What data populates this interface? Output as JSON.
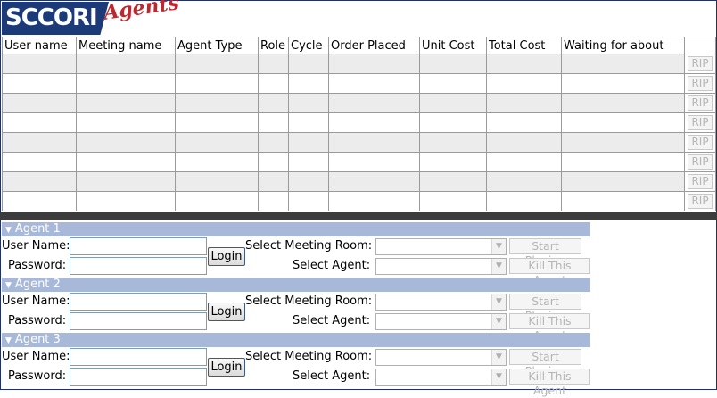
{
  "logo": {
    "brand": "SCCORI",
    "product": "Agents"
  },
  "table": {
    "headers": [
      "User name",
      "Meeting name",
      "Agent Type",
      "Role",
      "Cycle",
      "Order Placed",
      "Unit Cost",
      "Total Cost",
      "Waiting for about",
      ""
    ],
    "row_count": 8,
    "rip_label": "RIP"
  },
  "agents": [
    {
      "title": "Agent 1",
      "username_label": "User Name:",
      "password_label": "Password:",
      "username": "",
      "password": "",
      "login_label": "Login",
      "meeting_label": "Select Meeting Room:",
      "agent_label": "Select Agent:",
      "meeting_value": "",
      "agent_value": "",
      "start_label": "Start Playing",
      "kill_label": "Kill This Agent"
    },
    {
      "title": "Agent 2",
      "username_label": "User Name:",
      "password_label": "Password:",
      "username": "",
      "password": "",
      "login_label": "Login",
      "meeting_label": "Select Meeting Room:",
      "agent_label": "Select Agent:",
      "meeting_value": "",
      "agent_value": "",
      "start_label": "Start Playing",
      "kill_label": "Kill This Agent"
    },
    {
      "title": "Agent 3",
      "username_label": "User Name:",
      "password_label": "Password:",
      "username": "",
      "password": "",
      "login_label": "Login",
      "meeting_label": "Select Meeting Room:",
      "agent_label": "Select Agent:",
      "meeting_value": "",
      "agent_value": "",
      "start_label": "Start Playing",
      "kill_label": "Kill This Agent"
    }
  ],
  "colors": {
    "header_band": "#a8b8d8",
    "logo_blue": "#1d3a78",
    "logo_red": "#c0262d",
    "row_alt": "#ececec"
  }
}
